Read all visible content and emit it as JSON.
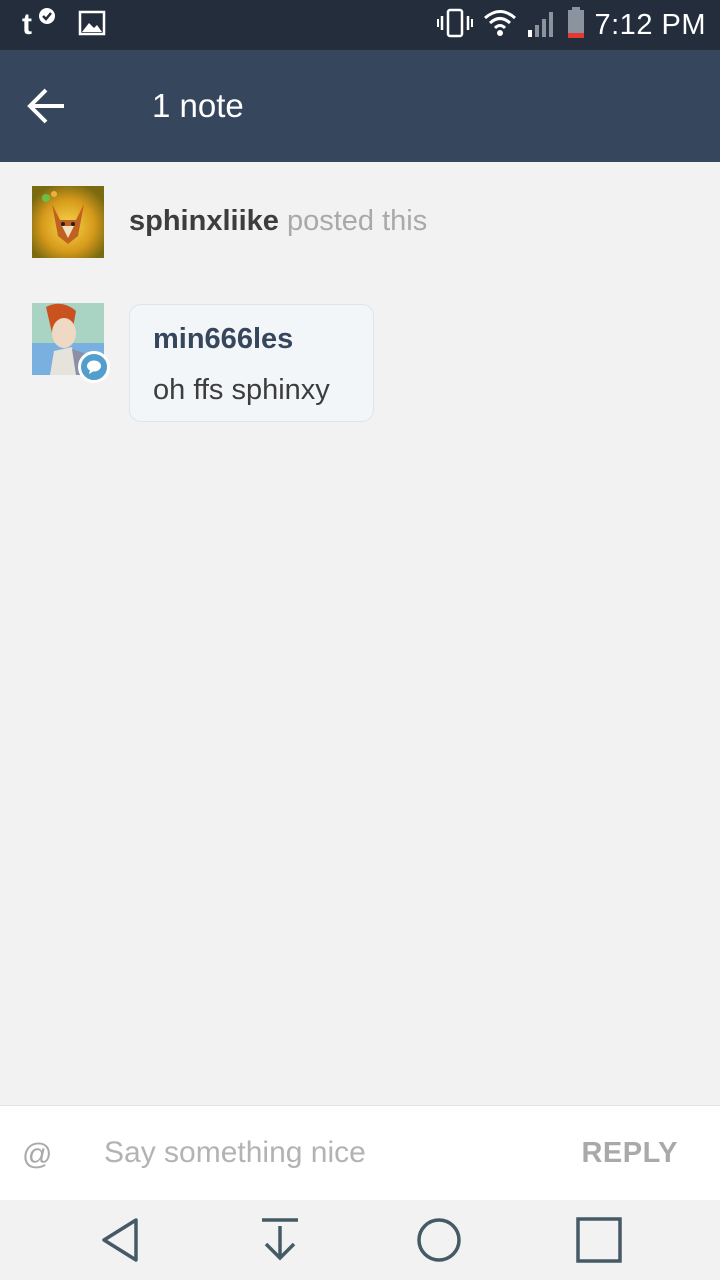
{
  "status_bar": {
    "time": "7:12 PM",
    "icons": [
      "tumblr-notification-icon",
      "image-notification-icon",
      "vibrate-icon",
      "wifi-icon",
      "cell-signal-icon",
      "battery-low-icon"
    ],
    "battery_color": "#e53935"
  },
  "app_bar": {
    "title": "1 note",
    "background": "#36465d"
  },
  "notes": [
    {
      "type": "post",
      "username": "sphinxliike",
      "action": "posted this"
    },
    {
      "type": "reply",
      "username": "min666les",
      "text": "oh ffs sphinxy",
      "badge_icon": "comment-icon"
    }
  ],
  "reply_bar": {
    "mention_label": "@",
    "placeholder": "Say something nice",
    "value": "",
    "reply_label": "REPLY"
  },
  "nav_bar": {
    "buttons": [
      "back-icon",
      "download-icon",
      "home-icon",
      "recents-icon"
    ]
  }
}
